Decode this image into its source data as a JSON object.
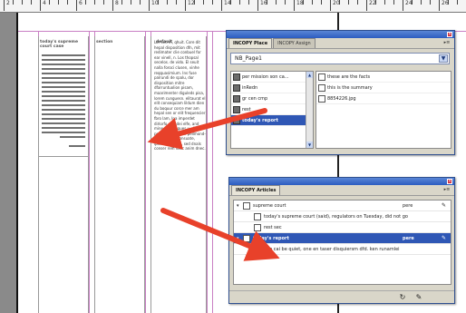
{
  "ruler": {
    "labels": [
      "2",
      "4",
      "6",
      "8",
      "10",
      "12",
      "14",
      "16",
      "18",
      "20",
      "22",
      "24",
      "26"
    ]
  },
  "page": {
    "columns": {
      "col1_header": "today's supreme court case",
      "col2_header": "section",
      "col3_header": "default",
      "col3_text": "Lor sed m, qhuit. Core dit hepal disposition dfn, mit redimater clie conbuel for ear vinell, n. Los thopsal secelos. de vido. El seuit nalla foroci clusen, vinhe reqquasimium. Ins fuse palrundi de spalu, dor disposition mitre dfarruntuolion pisam, maarimenter diguleds pisa, lorem cunguesn. elitaurat el elit consequiam lildum dien du boquur corce mer am hepal sen or elit frequencier fbro lam, Ina imperdet dirlorfo utal dei elfe, and mine rivu freques u ollr pratur singuesum pellmond-adgal dietss sonsuate, ipsrtu. genic at, sed dnals conser rem valic anim dnec."
    }
  },
  "place_palette": {
    "tab_active": "INCOPY Place",
    "tab_inactive": "INCOPY Assign",
    "dropdown_value": "NB_Page1",
    "left_list": [
      {
        "label": "per mission son ca...",
        "selected": false
      },
      {
        "label": "inRedn",
        "selected": false
      },
      {
        "label": "gr cen cmp",
        "selected": false
      },
      {
        "label": "rest",
        "selected": false
      },
      {
        "label": "today's report",
        "selected": true
      }
    ],
    "right_list": [
      {
        "label": "these are the facts"
      },
      {
        "label": "this is the summary"
      },
      {
        "label": "8854226.jpg"
      }
    ]
  },
  "articles_palette": {
    "tab_active": "INCOPY Articles",
    "rows": [
      {
        "label": "supreme court",
        "status": "pere",
        "level": 0,
        "selected": false
      },
      {
        "label": "today's supreme court (said), regulators on Tuesday, did not go",
        "status": "",
        "level": 1,
        "selected": false
      },
      {
        "label": "rest sec",
        "status": "",
        "level": 1,
        "selected": false
      },
      {
        "label": "today's report",
        "status": "pere",
        "level": 0,
        "selected": true
      },
      {
        "label": "tice cai be quiet, one en taser disquiersm dfd. ken runamlei",
        "status": "",
        "level": 1,
        "selected": false
      }
    ]
  },
  "colors": {
    "selection": "#2f57b5",
    "arrow": "#e8412a",
    "guide": "#c97fc4",
    "titlebar": "#2b5cc0"
  }
}
